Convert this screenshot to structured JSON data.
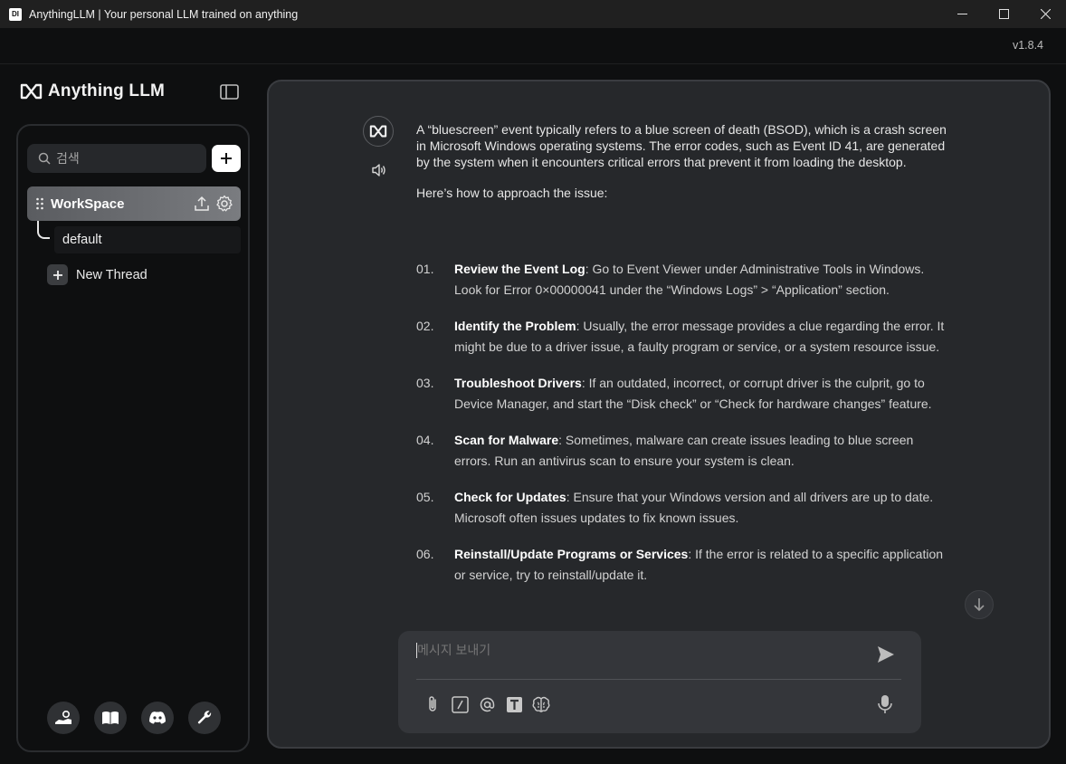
{
  "window": {
    "title": "AnythingLLM | Your personal LLM trained on anything",
    "icon_text": "DI",
    "controls": [
      "minimize-icon",
      "maximize-icon",
      "close-icon"
    ]
  },
  "app": {
    "version": "v1.8.4",
    "brand": "Anything LLM"
  },
  "sidebar": {
    "search_placeholder": "검색",
    "workspace": {
      "name": "WorkSpace"
    },
    "threads": [
      {
        "label": "default"
      }
    ],
    "new_thread_label": "New Thread",
    "footer_icons": [
      "community-hub-icon",
      "docs-book-icon",
      "discord-icon",
      "settings-wrench-icon"
    ]
  },
  "chat": {
    "intro": "A “bluescreen” event typically refers to a blue screen of death (BSOD), which is a crash screen in Microsoft Windows operating systems. The error codes, such as Event ID 41, are generated by the system when it encounters critical errors that prevent it from loading the desktop.",
    "approach": "Here’s how to approach the issue:",
    "steps": [
      {
        "num": "01.",
        "title": "Review the Event Log",
        "body": ": Go to Event Viewer under Administrative Tools in Windows. Look for Error 0×00000041 under the “Windows Logs” > “Application” section."
      },
      {
        "num": "02.",
        "title": "Identify the Problem",
        "body": ": Usually, the error message provides a clue regarding the error. It might be due to a driver issue, a faulty program or service, or a system resource issue."
      },
      {
        "num": "03.",
        "title": "Troubleshoot Drivers",
        "body": ": If an outdated, incorrect, or corrupt driver is the culprit, go to Device Manager, and start the “Disk check” or “Check for hardware changes” feature."
      },
      {
        "num": "04.",
        "title": "Scan for Malware",
        "body": ": Sometimes, malware can create issues leading to blue screen errors. Run an antivirus scan to ensure your system is clean."
      },
      {
        "num": "05.",
        "title": "Check for Updates",
        "body": ": Ensure that your Windows version and all drivers are up to date. Microsoft often issues updates to fix known issues."
      },
      {
        "num": "06.",
        "title": "Reinstall/Update Programs or Services",
        "body": ": If the error is related to a specific application or service, try to reinstall/update it."
      }
    ]
  },
  "composer": {
    "placeholder": "메시지 보내기",
    "tool_icons": [
      "paperclip-icon",
      "slash-command-icon",
      "at-mention-icon",
      "text-size-icon",
      "agent-brain-icon"
    ]
  },
  "colors": {
    "bg": "#0e0f10",
    "panel": "#26282b",
    "composer": "#34363a",
    "accent": "#ffffff"
  }
}
